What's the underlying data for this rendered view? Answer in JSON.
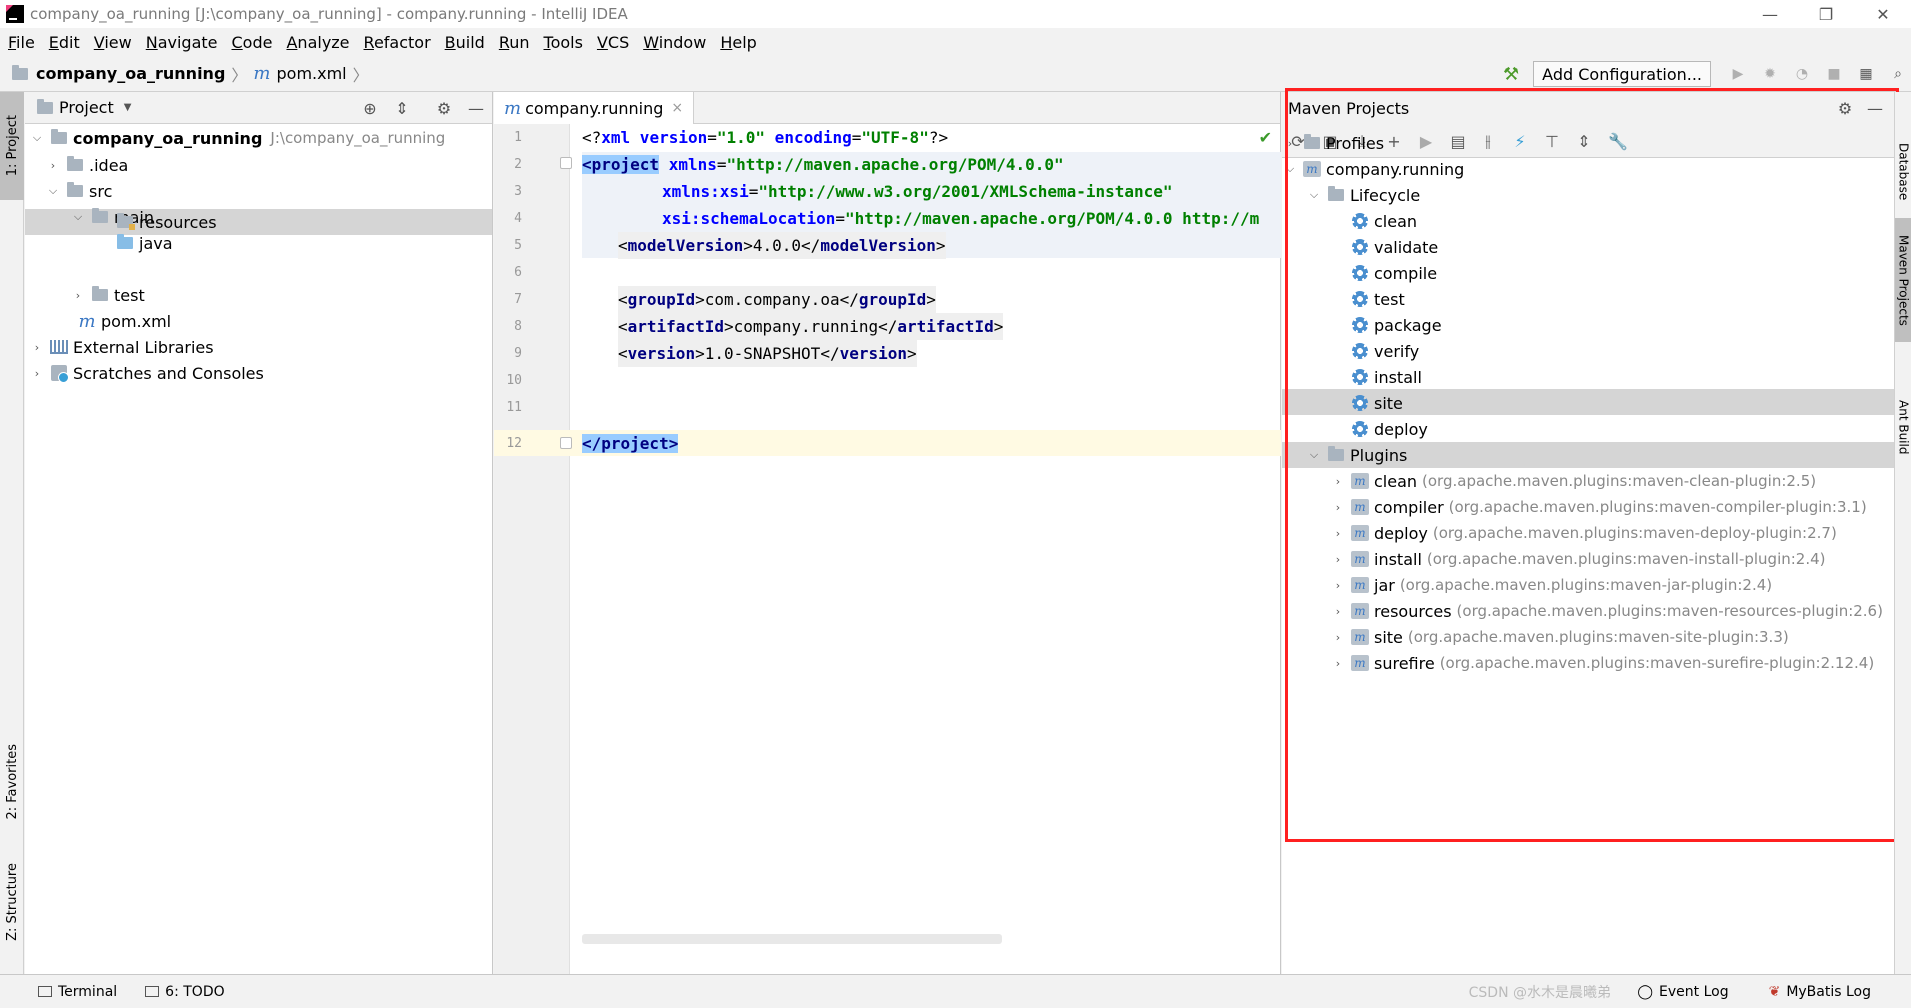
{
  "window": {
    "title": "company_oa_running [J:\\company_oa_running] - company.running - IntelliJ IDEA",
    "minimize": "—",
    "maximize": "❐",
    "close": "✕"
  },
  "menu": [
    "File",
    "Edit",
    "View",
    "Navigate",
    "Code",
    "Analyze",
    "Refactor",
    "Build",
    "Run",
    "Tools",
    "VCS",
    "Window",
    "Help"
  ],
  "breadcrumb": {
    "project": "company_oa_running",
    "file": "pom.xml",
    "sep": "〉"
  },
  "toolbar": {
    "add_configuration": "Add Configuration..."
  },
  "left_stripe": {
    "project": "1: Project",
    "favorites": "2: Favorites",
    "structure": "Z: Structure"
  },
  "right_stripe": {
    "database": "Database",
    "maven": "Maven Projects",
    "ant": "Ant Build"
  },
  "project_panel": {
    "title": "Project",
    "tree": [
      {
        "label": "company_oa_running",
        "extra": "J:\\company_oa_running",
        "expanded": true
      },
      {
        "label": ".idea",
        "expanded": false
      },
      {
        "label": "src",
        "expanded": true
      },
      {
        "label": "main",
        "expanded": true
      },
      {
        "label": "java"
      },
      {
        "label": "resources",
        "selected": true
      },
      {
        "label": "test",
        "expanded": false
      },
      {
        "label": "pom.xml"
      },
      {
        "label": "External Libraries",
        "expanded": false
      },
      {
        "label": "Scratches and Consoles",
        "expanded": false
      }
    ]
  },
  "editor": {
    "tab_label": "company.running",
    "tab_close": "×",
    "line_numbers": [
      "1",
      "2",
      "3",
      "4",
      "5",
      "6",
      "7",
      "8",
      "9",
      "10",
      "11",
      "12"
    ],
    "code": {
      "l1": {
        "open": "<?",
        "tag": "xml",
        "a1": " version",
        "eq1": "=",
        "v1": "\"1.0\"",
        "a2": " encoding",
        "eq2": "=",
        "v2": "\"UTF-8\"",
        "close": "?>"
      },
      "l2": {
        "tag": "<project",
        "attr": " xmlns",
        "eq": "=",
        "val": "\"http://maven.apache.org/POM/4.0.0\""
      },
      "l3": {
        "attr": "xmlns:xsi",
        "eq": "=",
        "val": "\"http://www.w3.org/2001/XMLSchema-instance\""
      },
      "l4": {
        "attr": "xsi:schemaLocation",
        "eq": "=",
        "val": "\"http://maven.apache.org/POM/4.0.0 http://m"
      },
      "l5": {
        "o": "<",
        "tag": "modelVersion",
        "c": ">",
        "text": "4.0.0",
        "eo": "</",
        "etag": "modelVersion",
        "ec": ">"
      },
      "l7": {
        "o": "<",
        "tag": "groupId",
        "c": ">",
        "text": "com.company.oa",
        "eo": "</",
        "etag": "groupId",
        "ec": ">"
      },
      "l8": {
        "o": "<",
        "tag": "artifactId",
        "c": ">",
        "text": "company.running",
        "eo": "</",
        "etag": "artifactId",
        "ec": ">"
      },
      "l9": {
        "o": "<",
        "tag": "version",
        "c": ">",
        "text": "1.0-SNAPSHOT",
        "eo": "</",
        "etag": "version",
        "ec": ">"
      },
      "l12": {
        "tag": "</project>"
      }
    }
  },
  "maven_panel": {
    "title": "Maven Projects",
    "profiles": "Profiles",
    "project": "company.running",
    "lifecycle": "Lifecycle",
    "phases": [
      "clean",
      "validate",
      "compile",
      "test",
      "package",
      "verify",
      "install",
      "site",
      "deploy"
    ],
    "plugins_label": "Plugins",
    "plugins": [
      {
        "name": "clean",
        "gav": "(org.apache.maven.plugins:maven-clean-plugin:2.5)"
      },
      {
        "name": "compiler",
        "gav": "(org.apache.maven.plugins:maven-compiler-plugin:3.1)"
      },
      {
        "name": "deploy",
        "gav": "(org.apache.maven.plugins:maven-deploy-plugin:2.7)"
      },
      {
        "name": "install",
        "gav": "(org.apache.maven.plugins:maven-install-plugin:2.4)"
      },
      {
        "name": "jar",
        "gav": "(org.apache.maven.plugins:maven-jar-plugin:2.4)"
      },
      {
        "name": "resources",
        "gav": "(org.apache.maven.plugins:maven-resources-plugin:2.6)"
      },
      {
        "name": "site",
        "gav": "(org.apache.maven.plugins:maven-site-plugin:3.3)"
      },
      {
        "name": "surefire",
        "gav": "(org.apache.maven.plugins:maven-surefire-plugin:2.12.4)"
      }
    ]
  },
  "statusbar": {
    "terminal": "Terminal",
    "todo": "6: TODO",
    "event_log": "Event Log",
    "mybatis_log": "MyBatis Log",
    "watermark": "CSDN @水木是晨曦弟"
  },
  "colors": {
    "highlight_box": "#ff2020",
    "tag": "#000080",
    "attr": "#0000ff",
    "value": "#008000"
  }
}
